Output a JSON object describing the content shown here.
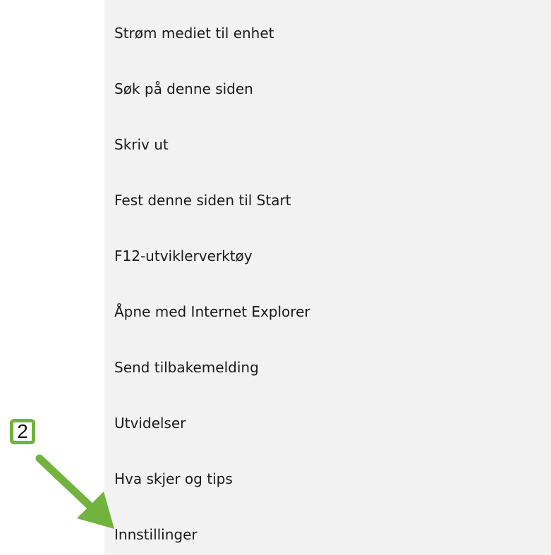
{
  "menu": {
    "items": [
      {
        "label": "Strøm mediet til enhet"
      },
      {
        "label": "Søk på denne siden"
      },
      {
        "label": "Skriv ut"
      },
      {
        "label": "Fest denne siden til Start"
      },
      {
        "label": "F12-utviklerverktøy"
      },
      {
        "label": "Åpne med Internet Explorer"
      },
      {
        "label": "Send tilbakemelding"
      },
      {
        "label": "Utvidelser"
      },
      {
        "label": "Hva skjer og tips"
      },
      {
        "label": "Innstillinger"
      }
    ]
  },
  "annotation": {
    "step_number": "2",
    "accent_color": "#71b33e"
  },
  "colors": {
    "panel_background": "#f2f2f2",
    "text": "#1a1a1a"
  }
}
